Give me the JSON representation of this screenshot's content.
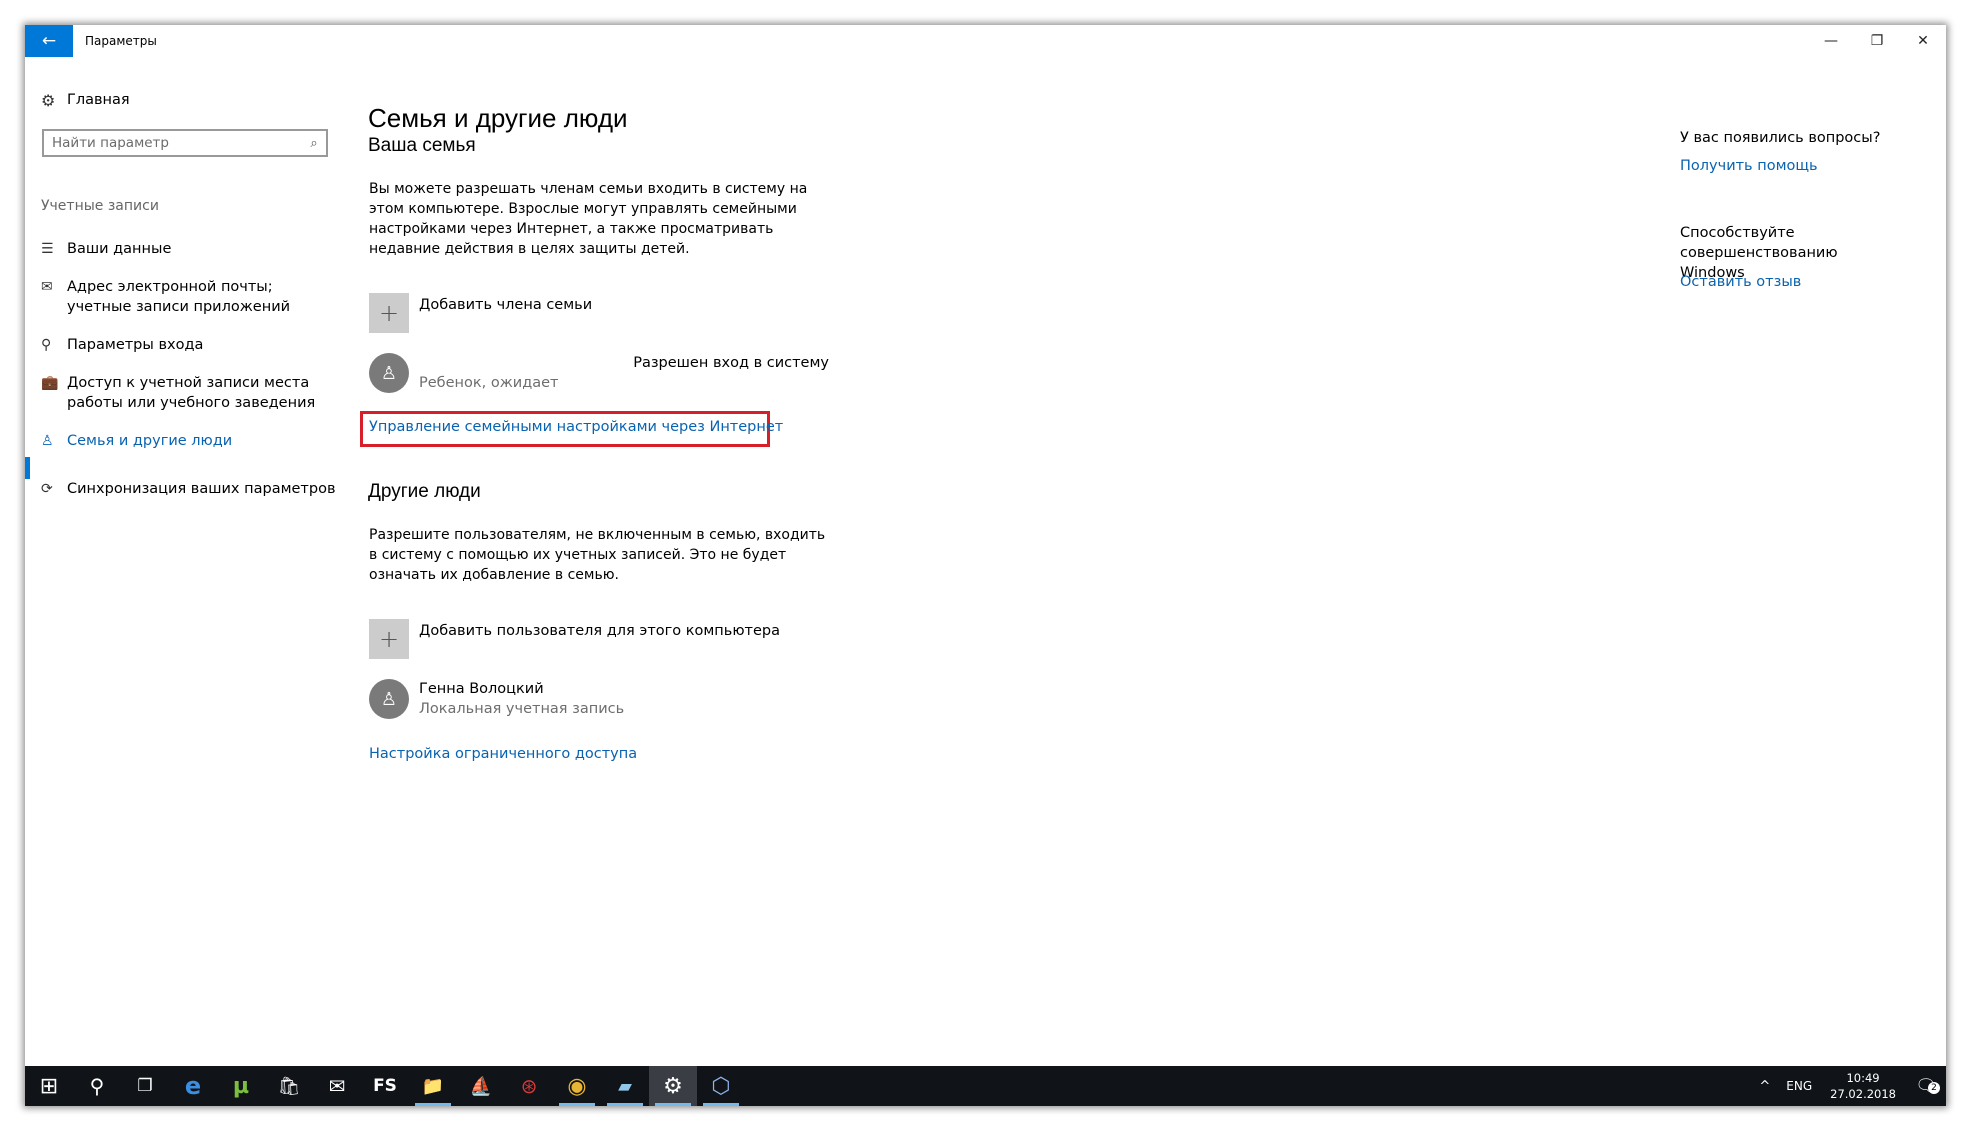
{
  "window": {
    "title": "Параметры",
    "back_icon": "←",
    "min_icon": "—",
    "max_icon": "❐",
    "close_icon": "✕"
  },
  "sidebar": {
    "home_label": "Главная",
    "home_icon": "⚙",
    "search_placeholder": "Найти параметр",
    "search_icon": "⌕",
    "section_label": "Учетные записи",
    "items": [
      {
        "label": "Ваши данные",
        "icon": "☰"
      },
      {
        "label": "Адрес электронной почты; учетные записи приложений",
        "icon": "✉"
      },
      {
        "label": "Параметры входа",
        "icon": "⚲"
      },
      {
        "label": "Доступ к учетной записи места работы или учебного заведения",
        "icon": "💼"
      },
      {
        "label": "Семья и другие люди",
        "icon": "♙"
      },
      {
        "label": "Синхронизация ваших параметров",
        "icon": "⟳"
      }
    ],
    "active_index": 4
  },
  "main": {
    "title": "Семья и другие люди",
    "family": {
      "heading": "Ваша семья",
      "description": "Вы можете разрешать членам семьи входить в систему на этом компьютере. Взрослые могут управлять семейными настройками через Интернет, а также просматривать недавние действия в целях защиты детей.",
      "add_label": "Добавить члена семьи",
      "member": {
        "role": "Ребенок, ожидает",
        "status": "Разрешен вход в систему"
      },
      "manage_link": "Управление семейными настройками через Интернет"
    },
    "others": {
      "heading": "Другие люди",
      "description": "Разрешите пользователям, не включенным в семью, входить в систему с помощью их учетных записей. Это не будет означать их добавление в семью.",
      "add_label": "Добавить пользователя для этого компьютера",
      "user": {
        "name": "Генна Волоцкий",
        "type": "Локальная учетная запись"
      },
      "restricted_link": "Настройка ограниченного доступа"
    }
  },
  "help": {
    "question": "У вас появились вопросы?",
    "help_link": "Получить помощь",
    "improve_text": "Способствуйте совершенствованию Windows",
    "feedback_link": "Оставить отзыв"
  },
  "taskbar": {
    "icons": [
      {
        "name": "start",
        "glyph": "⊞"
      },
      {
        "name": "search",
        "glyph": "⚲"
      },
      {
        "name": "task-view",
        "glyph": "❐"
      },
      {
        "name": "edge",
        "glyph": "e",
        "color": "#3c8ee0"
      },
      {
        "name": "utorrent",
        "glyph": "µ",
        "color": "#7cbf3e"
      },
      {
        "name": "store",
        "glyph": "🛍"
      },
      {
        "name": "mail",
        "glyph": "✉"
      },
      {
        "name": "fs",
        "glyph": "FS"
      },
      {
        "name": "file-explorer",
        "glyph": "📁",
        "color": "#f2c94c"
      },
      {
        "name": "app-1",
        "glyph": "⛵",
        "color": "#7fb3e8"
      },
      {
        "name": "app-2",
        "glyph": "⊛",
        "color": "#d23a3a"
      },
      {
        "name": "chrome",
        "glyph": "◉",
        "color": "#e8b535"
      },
      {
        "name": "app-3",
        "glyph": "▰",
        "color": "#8fc7e8"
      },
      {
        "name": "settings",
        "glyph": "⚙"
      },
      {
        "name": "virtualbox",
        "glyph": "⬡",
        "color": "#8fb4e8"
      }
    ],
    "tray_chevron": "^",
    "language": "ENG",
    "time": "10:49",
    "date": "27.02.2018",
    "notification_icon": "🗨",
    "notification_count": "2"
  }
}
